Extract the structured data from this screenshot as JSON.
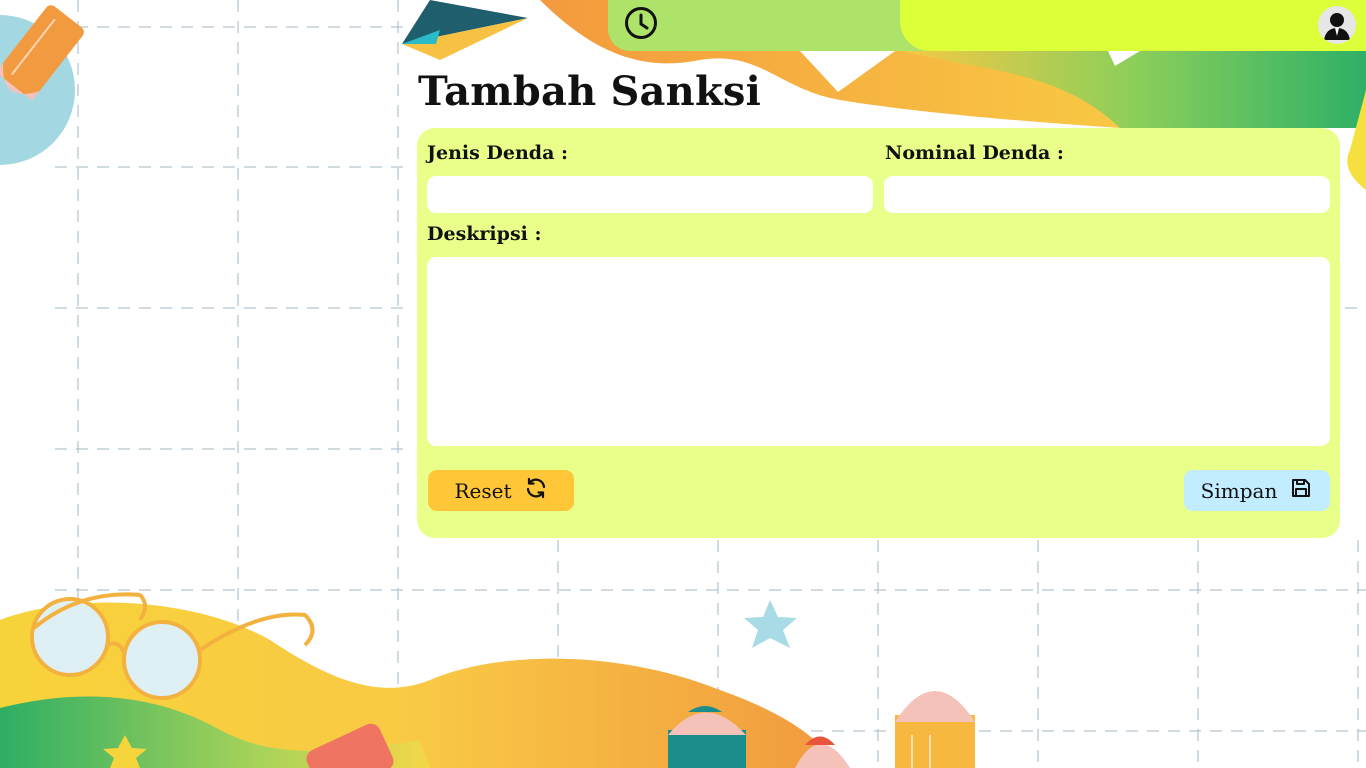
{
  "header": {
    "clock_icon": "clock-icon",
    "avatar_icon": "user-avatar-icon",
    "colors": {
      "bar_left": "#aee36a",
      "bar_right": "#ddff3a"
    }
  },
  "page": {
    "title": "Tambah Sanksi"
  },
  "form": {
    "jenis_denda": {
      "label": "Jenis Denda :",
      "value": "",
      "placeholder": ""
    },
    "nominal_denda": {
      "label": "Nominal Denda :",
      "value": "",
      "placeholder": ""
    },
    "deskripsi": {
      "label": "Deskripsi :",
      "value": "",
      "placeholder": ""
    },
    "reset_label": "Reset",
    "reset_icon": "refresh-icon",
    "save_label": "Simpan",
    "save_icon": "floppy-disk-icon",
    "colors": {
      "card": "#e8ff8a",
      "reset": "#ffc638",
      "save": "#c2ecff"
    }
  }
}
